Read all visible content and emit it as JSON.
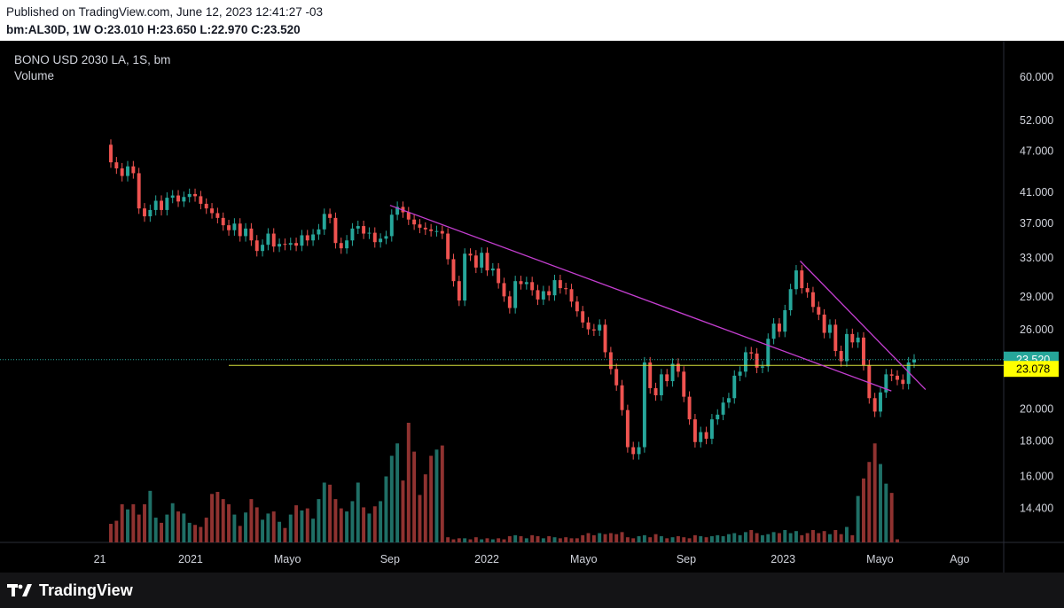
{
  "header": {
    "published": "Published on TradingView.com, June 12, 2023 12:41:27 -03",
    "ohlc": "bm:AL30D, 1W O:23.010 H:23.650 L:22.970 C:23.520"
  },
  "legend": {
    "title": "BONO USD 2030 LA, 1S, bm",
    "subtitle": "Volume"
  },
  "brand": {
    "name": "TradingView"
  },
  "colors": {
    "up": "#26a69a",
    "down": "#ef5350",
    "up_volume": "#1f6f66",
    "down_volume": "#8f3230",
    "trendline": "#c33ecf",
    "support": "#d6e03a",
    "last_price_label": "#26a69a",
    "support_label": "#ffff00"
  },
  "chart_data": {
    "type": "candlestick",
    "timeframe": "1W",
    "symbol": "bm:AL30D",
    "price_axis": {
      "scale": "log",
      "ticks": [
        "60.000",
        "52.000",
        "47.000",
        "41.000",
        "37.000",
        "33.000",
        "29.000",
        "26.000",
        "20.000",
        "18.000",
        "16.000",
        "14.400"
      ],
      "range": [
        13.3,
        63
      ]
    },
    "time_axis": {
      "ticks": [
        "21",
        "2021",
        "Mayo",
        "Sep",
        "2022",
        "Mayo",
        "Sep",
        "2023",
        "Mayo",
        "Ago"
      ],
      "start": "2020-09-28",
      "last_bar": "2023-06-12"
    },
    "last_price": {
      "label": "23.520",
      "value": 23.52
    },
    "support_level": {
      "label": "23.078",
      "value": 23.078
    },
    "trendlines": [
      {
        "name": "",
        "from": {
          "date": "2021-09-06",
          "price": 39.2
        },
        "to": {
          "date": "2023-05-15",
          "price": 21.2
        }
      },
      {
        "name": "",
        "from": {
          "date": "2023-01-23",
          "price": 32.6
        },
        "to": {
          "date": "2023-06-26",
          "price": 21.3
        }
      }
    ],
    "closes": [
      45.2,
      44.3,
      43.2,
      44.6,
      43.6,
      38.8,
      37.8,
      38.6,
      39.8,
      38.6,
      40.2,
      40.5,
      39.7,
      40.3,
      40.7,
      40.4,
      39.4,
      38.8,
      38.2,
      37.6,
      36.7,
      36.1,
      36.9,
      35.4,
      36.3,
      34.9,
      33.7,
      34.4,
      35.7,
      34.2,
      34.5,
      34.4,
      34.6,
      34.3,
      35.5,
      34.9,
      35.6,
      36.2,
      38.1,
      37.6,
      34.6,
      34.0,
      34.9,
      36.3,
      36.6,
      35.7,
      35.8,
      34.7,
      35.1,
      35.4,
      38.0,
      39.0,
      38.3,
      37.4,
      36.8,
      36.4,
      36.2,
      36.0,
      36.0,
      35.7,
      32.8,
      30.5,
      28.6,
      33.4,
      33.2,
      31.9,
      33.5,
      31.6,
      31.8,
      30.3,
      29.0,
      27.9,
      30.5,
      30.2,
      30.4,
      29.6,
      28.7,
      29.5,
      29.1,
      30.6,
      29.8,
      29.7,
      28.5,
      27.6,
      26.6,
      26.0,
      25.9,
      26.4,
      24.1,
      22.8,
      21.6,
      19.9,
      17.6,
      17.2,
      17.6,
      23.3,
      21.4,
      20.9,
      22.4,
      21.9,
      23.2,
      22.6,
      20.8,
      19.3,
      17.9,
      18.5,
      18.1,
      19.3,
      19.6,
      20.4,
      20.7,
      22.3,
      22.6,
      24.1,
      24.0,
      22.9,
      23.0,
      25.2,
      26.5,
      25.8,
      27.7,
      29.7,
      31.6,
      29.8,
      29.4,
      28.0,
      27.3,
      25.7,
      26.4,
      24.2,
      23.4,
      25.6,
      24.9,
      25.3,
      23.1,
      20.7,
      19.8,
      21.1,
      22.4,
      22.3,
      22.0,
      21.7,
      23.3,
      23.52
    ],
    "volumes": [
      0.9,
      1.05,
      1.85,
      1.6,
      1.85,
      1.35,
      1.85,
      2.5,
      1.2,
      0.95,
      1.35,
      1.9,
      1.5,
      1.4,
      0.95,
      0.85,
      0.75,
      1.2,
      2.35,
      2.45,
      2.1,
      1.85,
      1.35,
      0.8,
      1.45,
      2.1,
      1.7,
      1.1,
      1.4,
      1.5,
      1.0,
      0.7,
      1.35,
      1.8,
      1.55,
      1.65,
      1.15,
      2.1,
      2.9,
      2.8,
      2.1,
      1.65,
      1.5,
      2.0,
      2.9,
      1.7,
      1.4,
      1.75,
      2.0,
      3.2,
      4.2,
      4.8,
      3.0,
      5.8,
      4.4,
      2.3,
      3.3,
      4.2,
      4.5,
      4.7,
      0.25,
      0.15,
      0.2,
      0.2,
      0.15,
      0.25,
      0.15,
      0.2,
      0.15,
      0.2,
      0.15,
      0.3,
      0.35,
      0.3,
      0.2,
      0.35,
      0.3,
      0.2,
      0.3,
      0.25,
      0.2,
      0.25,
      0.2,
      0.2,
      0.35,
      0.45,
      0.35,
      0.45,
      0.4,
      0.45,
      0.4,
      0.5,
      0.25,
      0.2,
      0.3,
      0.35,
      0.25,
      0.4,
      0.3,
      0.2,
      0.25,
      0.3,
      0.25,
      0.2,
      0.35,
      0.3,
      0.25,
      0.3,
      0.35,
      0.3,
      0.4,
      0.45,
      0.35,
      0.5,
      0.6,
      0.45,
      0.35,
      0.4,
      0.5,
      0.45,
      0.6,
      0.45,
      0.55,
      0.35,
      0.45,
      0.6,
      0.45,
      0.55,
      0.4,
      0.6,
      0.4,
      0.75,
      0.35,
      2.25,
      3.1,
      3.9,
      4.8,
      3.8,
      2.85,
      2.4,
      0.15
    ]
  }
}
